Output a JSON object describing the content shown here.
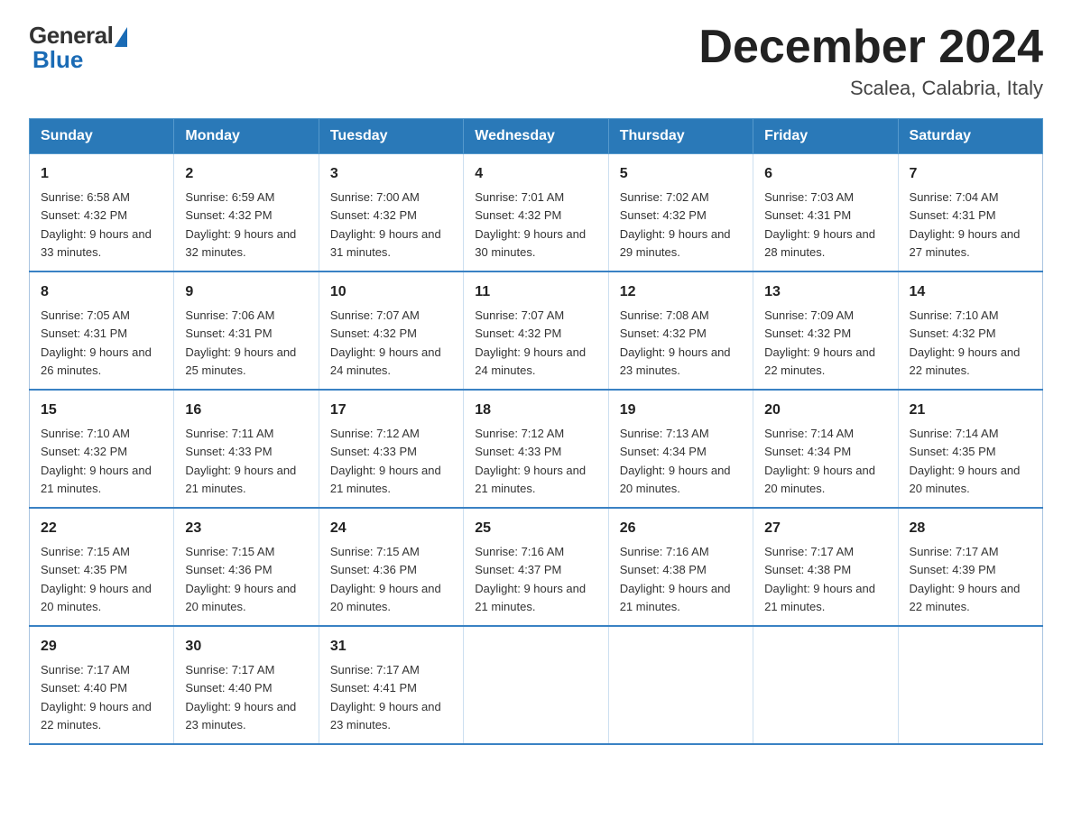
{
  "header": {
    "logo_general": "General",
    "logo_blue": "Blue",
    "month_title": "December 2024",
    "location": "Scalea, Calabria, Italy"
  },
  "calendar": {
    "days_of_week": [
      "Sunday",
      "Monday",
      "Tuesday",
      "Wednesday",
      "Thursday",
      "Friday",
      "Saturday"
    ],
    "weeks": [
      [
        {
          "day": "1",
          "sunrise": "6:58 AM",
          "sunset": "4:32 PM",
          "daylight": "9 hours and 33 minutes."
        },
        {
          "day": "2",
          "sunrise": "6:59 AM",
          "sunset": "4:32 PM",
          "daylight": "9 hours and 32 minutes."
        },
        {
          "day": "3",
          "sunrise": "7:00 AM",
          "sunset": "4:32 PM",
          "daylight": "9 hours and 31 minutes."
        },
        {
          "day": "4",
          "sunrise": "7:01 AM",
          "sunset": "4:32 PM",
          "daylight": "9 hours and 30 minutes."
        },
        {
          "day": "5",
          "sunrise": "7:02 AM",
          "sunset": "4:32 PM",
          "daylight": "9 hours and 29 minutes."
        },
        {
          "day": "6",
          "sunrise": "7:03 AM",
          "sunset": "4:31 PM",
          "daylight": "9 hours and 28 minutes."
        },
        {
          "day": "7",
          "sunrise": "7:04 AM",
          "sunset": "4:31 PM",
          "daylight": "9 hours and 27 minutes."
        }
      ],
      [
        {
          "day": "8",
          "sunrise": "7:05 AM",
          "sunset": "4:31 PM",
          "daylight": "9 hours and 26 minutes."
        },
        {
          "day": "9",
          "sunrise": "7:06 AM",
          "sunset": "4:31 PM",
          "daylight": "9 hours and 25 minutes."
        },
        {
          "day": "10",
          "sunrise": "7:07 AM",
          "sunset": "4:32 PM",
          "daylight": "9 hours and 24 minutes."
        },
        {
          "day": "11",
          "sunrise": "7:07 AM",
          "sunset": "4:32 PM",
          "daylight": "9 hours and 24 minutes."
        },
        {
          "day": "12",
          "sunrise": "7:08 AM",
          "sunset": "4:32 PM",
          "daylight": "9 hours and 23 minutes."
        },
        {
          "day": "13",
          "sunrise": "7:09 AM",
          "sunset": "4:32 PM",
          "daylight": "9 hours and 22 minutes."
        },
        {
          "day": "14",
          "sunrise": "7:10 AM",
          "sunset": "4:32 PM",
          "daylight": "9 hours and 22 minutes."
        }
      ],
      [
        {
          "day": "15",
          "sunrise": "7:10 AM",
          "sunset": "4:32 PM",
          "daylight": "9 hours and 21 minutes."
        },
        {
          "day": "16",
          "sunrise": "7:11 AM",
          "sunset": "4:33 PM",
          "daylight": "9 hours and 21 minutes."
        },
        {
          "day": "17",
          "sunrise": "7:12 AM",
          "sunset": "4:33 PM",
          "daylight": "9 hours and 21 minutes."
        },
        {
          "day": "18",
          "sunrise": "7:12 AM",
          "sunset": "4:33 PM",
          "daylight": "9 hours and 21 minutes."
        },
        {
          "day": "19",
          "sunrise": "7:13 AM",
          "sunset": "4:34 PM",
          "daylight": "9 hours and 20 minutes."
        },
        {
          "day": "20",
          "sunrise": "7:14 AM",
          "sunset": "4:34 PM",
          "daylight": "9 hours and 20 minutes."
        },
        {
          "day": "21",
          "sunrise": "7:14 AM",
          "sunset": "4:35 PM",
          "daylight": "9 hours and 20 minutes."
        }
      ],
      [
        {
          "day": "22",
          "sunrise": "7:15 AM",
          "sunset": "4:35 PM",
          "daylight": "9 hours and 20 minutes."
        },
        {
          "day": "23",
          "sunrise": "7:15 AM",
          "sunset": "4:36 PM",
          "daylight": "9 hours and 20 minutes."
        },
        {
          "day": "24",
          "sunrise": "7:15 AM",
          "sunset": "4:36 PM",
          "daylight": "9 hours and 20 minutes."
        },
        {
          "day": "25",
          "sunrise": "7:16 AM",
          "sunset": "4:37 PM",
          "daylight": "9 hours and 21 minutes."
        },
        {
          "day": "26",
          "sunrise": "7:16 AM",
          "sunset": "4:38 PM",
          "daylight": "9 hours and 21 minutes."
        },
        {
          "day": "27",
          "sunrise": "7:17 AM",
          "sunset": "4:38 PM",
          "daylight": "9 hours and 21 minutes."
        },
        {
          "day": "28",
          "sunrise": "7:17 AM",
          "sunset": "4:39 PM",
          "daylight": "9 hours and 22 minutes."
        }
      ],
      [
        {
          "day": "29",
          "sunrise": "7:17 AM",
          "sunset": "4:40 PM",
          "daylight": "9 hours and 22 minutes."
        },
        {
          "day": "30",
          "sunrise": "7:17 AM",
          "sunset": "4:40 PM",
          "daylight": "9 hours and 23 minutes."
        },
        {
          "day": "31",
          "sunrise": "7:17 AM",
          "sunset": "4:41 PM",
          "daylight": "9 hours and 23 minutes."
        },
        null,
        null,
        null,
        null
      ]
    ]
  }
}
